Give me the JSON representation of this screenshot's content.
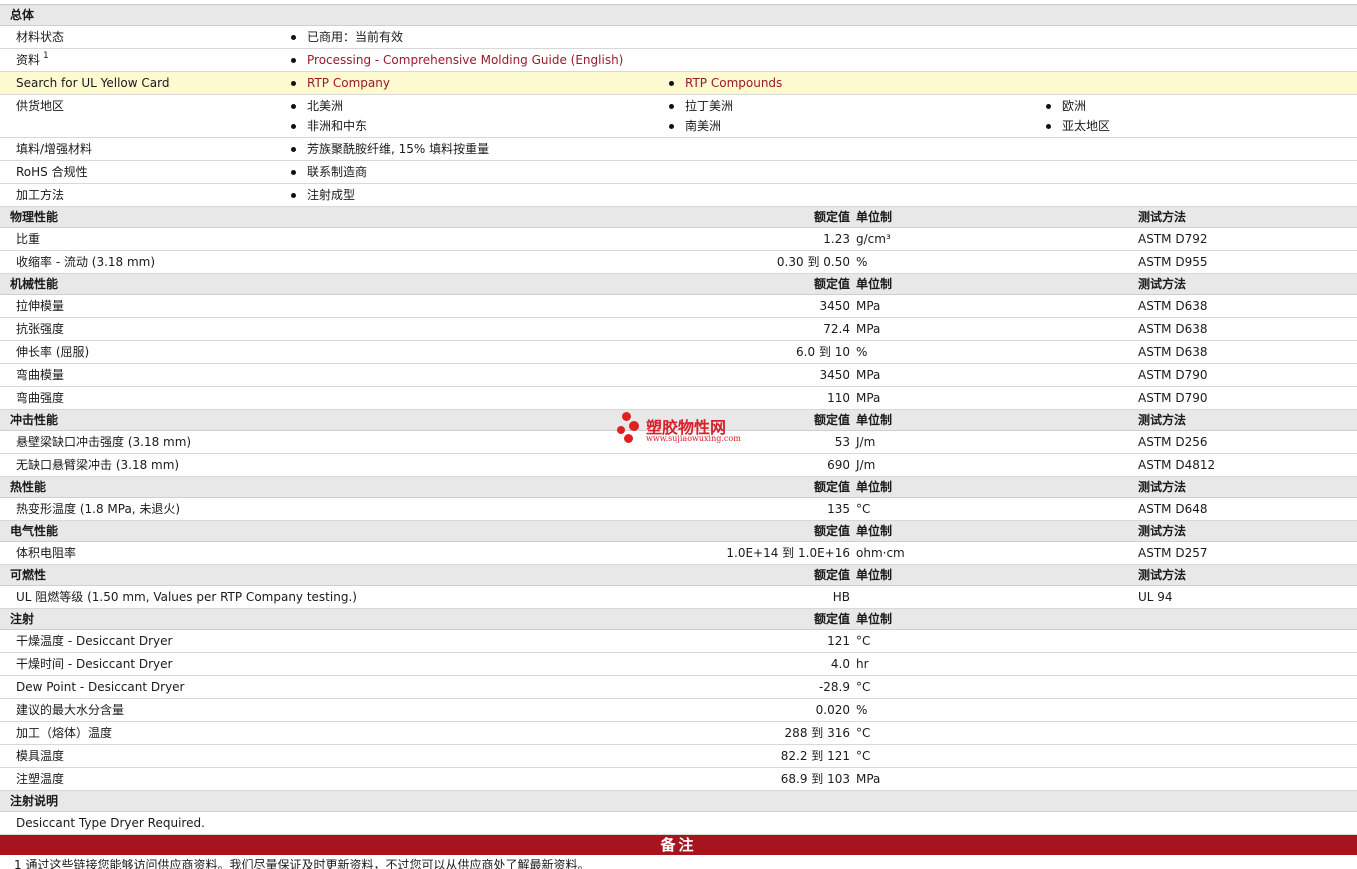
{
  "general": {
    "title": "总体",
    "status_label": "材料状态",
    "status_value": "已商用：当前有效",
    "docs_label": "资料",
    "docs_sup": "1",
    "docs_link": "Processing - Comprehensive Molding Guide (English)",
    "ul_label": "Search for UL Yellow Card",
    "ul_links": [
      "RTP Company",
      "RTP Compounds"
    ],
    "regions_label": "供货地区",
    "regions": [
      "北美洲",
      "拉丁美洲",
      "欧洲",
      "非洲和中东",
      "南美洲",
      "亚太地区"
    ],
    "filler_label": "填料/增强材料",
    "filler_value": "芳族聚酰胺纤维, 15% 填料按重量",
    "rohs_label": "RoHS 合规性",
    "rohs_value": "联系制造商",
    "process_label": "加工方法",
    "process_value": "注射成型"
  },
  "headers": {
    "value": "额定值",
    "unit": "单位制",
    "test": "测试方法"
  },
  "sections": [
    {
      "title": "物理性能",
      "show_test": true,
      "rows": [
        {
          "label": "比重",
          "value": "1.23",
          "unit": "g/cm³",
          "test": "ASTM D792"
        },
        {
          "label": "收缩率  - 流动  (3.18 mm)",
          "value": "0.30 到  0.50",
          "unit": "%",
          "test": "ASTM D955"
        }
      ]
    },
    {
      "title": "机械性能",
      "show_test": true,
      "rows": [
        {
          "label": "拉伸模量",
          "value": "3450",
          "unit": "MPa",
          "test": "ASTM D638"
        },
        {
          "label": "抗张强度",
          "value": "72.4",
          "unit": "MPa",
          "test": "ASTM D638"
        },
        {
          "label": "伸长率  (屈服)",
          "value": "6.0 到  10",
          "unit": "%",
          "test": "ASTM D638"
        },
        {
          "label": "弯曲模量",
          "value": "3450",
          "unit": "MPa",
          "test": "ASTM D790"
        },
        {
          "label": "弯曲强度",
          "value": "110",
          "unit": "MPa",
          "test": "ASTM D790"
        }
      ]
    },
    {
      "title": "冲击性能",
      "show_test": true,
      "rows": [
        {
          "label": "悬壁梁缺口冲击强度  (3.18 mm)",
          "value": "53",
          "unit": "J/m",
          "test": "ASTM D256"
        },
        {
          "label": "无缺口悬臂梁冲击  (3.18 mm)",
          "value": "690",
          "unit": "J/m",
          "test": "ASTM D4812"
        }
      ]
    },
    {
      "title": "热性能",
      "show_test": true,
      "rows": [
        {
          "label": "热变形温度  (1.8 MPa, 未退火)",
          "value": "135",
          "unit": "°C",
          "test": "ASTM D648"
        }
      ]
    },
    {
      "title": "电气性能",
      "show_test": true,
      "rows": [
        {
          "label": "体积电阻率",
          "value": "1.0E+14 到  1.0E+16",
          "unit": "ohm·cm",
          "test": "ASTM D257"
        }
      ]
    },
    {
      "title": "可燃性",
      "show_test": true,
      "rows": [
        {
          "label": "UL 阻燃等级  (1.50 mm, Values per RTP Company testing.)",
          "value": "HB",
          "unit": "",
          "test": "UL 94"
        }
      ]
    },
    {
      "title": "注射",
      "show_test": false,
      "rows": [
        {
          "label": "干燥温度  - Desiccant Dryer",
          "value": "121",
          "unit": "°C",
          "test": ""
        },
        {
          "label": "干燥时间  - Desiccant Dryer",
          "value": "4.0",
          "unit": "hr",
          "test": ""
        },
        {
          "label": "Dew Point - Desiccant Dryer",
          "value": "-28.9",
          "unit": "°C",
          "test": ""
        },
        {
          "label": "建议的最大水分含量",
          "value": "0.020",
          "unit": "%",
          "test": ""
        },
        {
          "label": "加工（熔体）温度",
          "value": "288 到  316",
          "unit": "°C",
          "test": ""
        },
        {
          "label": "模具温度",
          "value": "82.2 到  121",
          "unit": "°C",
          "test": ""
        },
        {
          "label": "注塑温度",
          "value": "68.9 到  103",
          "unit": "MPa",
          "test": ""
        }
      ]
    }
  ],
  "injection_notes": {
    "title": "注射说明",
    "text": "Desiccant Type Dryer Required."
  },
  "notes_bar": "备注",
  "footnote": "1 通过这些链接您能够访问供应商资料。我们尽量保证及时更新资料，不过您可以从供应商处了解最新资料。",
  "watermark": {
    "name": "塑胶物性网",
    "url": "www.sujiaowuxing.com",
    "color": "#d8202a"
  }
}
